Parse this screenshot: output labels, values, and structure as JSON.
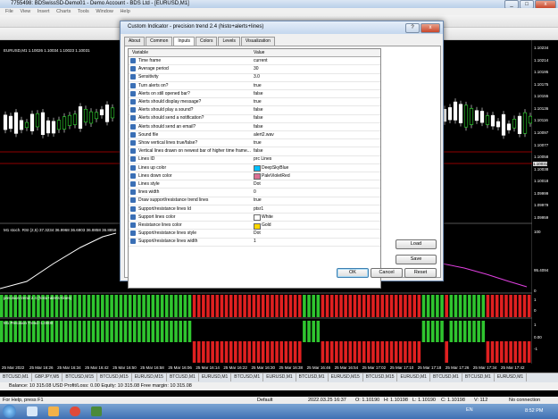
{
  "window": {
    "title": "7755498: BDSwissSD-Demo01 - Demo Account - BDS Ltd - [EURUSD,M1]",
    "controls": [
      "_",
      "□",
      "x"
    ]
  },
  "menu": [
    "File",
    "View",
    "Insert",
    "Charts",
    "Tools",
    "Window",
    "Help"
  ],
  "main_chart": {
    "symbol_label": "EURUSD,M1 1.10026 1.10034 1.10023 1.10031",
    "price_scale": [
      "1.10234",
      "1.10214",
      "1.10195",
      "1.10175",
      "1.10155",
      "1.10136",
      "1.10116",
      "1.10097",
      "1.10077",
      "1.10058",
      "1.10038",
      "1.10018",
      "1.09999",
      "1.09979",
      "1.09959"
    ],
    "current_price": "1.10031",
    "stoch_label": "M1 stoch. RSI (2,5) 37.3234 36.9968 36.6903 36.8858 36.8858",
    "stoch_scale": [
      "100",
      "95.4094",
      "0"
    ],
    "precision_label": "precision trend 2.4 (histo+alerts+lines)",
    "precision_scale": [
      "1",
      "0"
    ],
    "precision_trend_label": "M1 Precision Trend -1.0000",
    "precision_trend_scale": [
      "1",
      "0.00",
      "-1"
    ]
  },
  "time_axis": [
    "25 Mar 2022",
    "25 Mar 16:26",
    "25 Mar 16:34",
    "25 Mar 16:42",
    "25 Mar 16:50",
    "25 Mar 16:58",
    "25 Mar 16:06",
    "25 Mar 16:14",
    "25 Mar 16:22",
    "25 Mar 16:30",
    "25 Mar 16:38",
    "25 Mar 16:46",
    "25 Mar 16:54",
    "25 Mar 17:02",
    "25 Mar 17:10",
    "25 Mar 17:18",
    "25 Mar 17:26",
    "25 Mar 17:34",
    "25 Mar 17:42"
  ],
  "chart_tabs": [
    "BTCUSD,M1",
    "GBPJPY,M5",
    "BTCUSD,M15",
    "BTCUSD,M15",
    "EURUSD,M15",
    "BTCUSD,M1",
    "EURUSD,M1",
    "BTCUSD,M1",
    "EURUSD,M1",
    "BTCUSD,M1",
    "EURUSD,M15",
    "BTCUSD,M15",
    "EURUSD,M1",
    "BTCUSD,M1",
    "BTCUSD,M1",
    "EURUSD,M1"
  ],
  "balance_bar": "Balance: 10 315.08 USD  Profit/Loss: 0.00  Equity: 10 315.08  Free margin: 10 315.08",
  "status_bar": {
    "help": "For Help, press F1",
    "profile": "Default",
    "time": "2022.03.25 16:37",
    "open": "O: 1.10190",
    "high": "H: 1.10198",
    "low": "L: 1.10190",
    "close": "C: 1.10198",
    "volume": "V: 112",
    "connection": "No connection"
  },
  "taskbar": {
    "lang": "EN",
    "clock": "8:52 PM"
  },
  "dialog": {
    "title": "Custom Indicator - precision trend 2.4 (histo+alerts+lines)",
    "title_controls": [
      "?",
      "x"
    ],
    "tabs": [
      "About",
      "Common",
      "Inputs",
      "Colors",
      "Levels",
      "Visualization"
    ],
    "active_tab": "Inputs",
    "grid_header": {
      "variable": "Variable",
      "value": "Value"
    },
    "rows": [
      {
        "name": "Time frame",
        "value": "current"
      },
      {
        "name": "Average period",
        "value": "30"
      },
      {
        "name": "Sensitivity",
        "value": "3.0"
      },
      {
        "name": "Turn alerts on?",
        "value": "true"
      },
      {
        "name": "Alerts on still opened bar?",
        "value": "false"
      },
      {
        "name": "Alerts should display message?",
        "value": "true"
      },
      {
        "name": "Alerts should play a sound?",
        "value": "false"
      },
      {
        "name": "Alerts should send a notification?",
        "value": "false"
      },
      {
        "name": "Alerts should send an email?",
        "value": "false"
      },
      {
        "name": "Sound file",
        "value": "alert2.wav"
      },
      {
        "name": "Show vertical lines true/false?",
        "value": "true"
      },
      {
        "name": "Vertical lines drawn on newest bar of higher time frame...",
        "value": "false"
      },
      {
        "name": "Lines ID",
        "value": "prc Lines"
      },
      {
        "name": "Lines up color",
        "value": "DeepSkyBlue",
        "swatch": "#00bfff"
      },
      {
        "name": "Lines down color",
        "value": "PaleVioletRed",
        "swatch": "#db7093"
      },
      {
        "name": "Lines style",
        "value": "Dot"
      },
      {
        "name": "lines width",
        "value": "0"
      },
      {
        "name": "Draw support/resistance trend lines",
        "value": "true"
      },
      {
        "name": "Support/resistance lines Id",
        "value": "ptsr1"
      },
      {
        "name": "Support lines color",
        "value": "White",
        "swatch": "#ffffff"
      },
      {
        "name": "Resistance lines color",
        "value": "Gold",
        "swatch": "#ffd700"
      },
      {
        "name": "Support/resistance lines style",
        "value": "Dot"
      },
      {
        "name": "Support/resistance lines width",
        "value": "1"
      }
    ],
    "buttons": {
      "load": "Load",
      "save": "Save",
      "ok": "OK",
      "cancel": "Cancel",
      "reset": "Reset"
    }
  },
  "colors": {
    "bull": "#2fc52f",
    "bear": "#e02020",
    "candle": "#ffffff",
    "stoch_line": "#ffffff",
    "stoch_line2": "#e040e0"
  }
}
